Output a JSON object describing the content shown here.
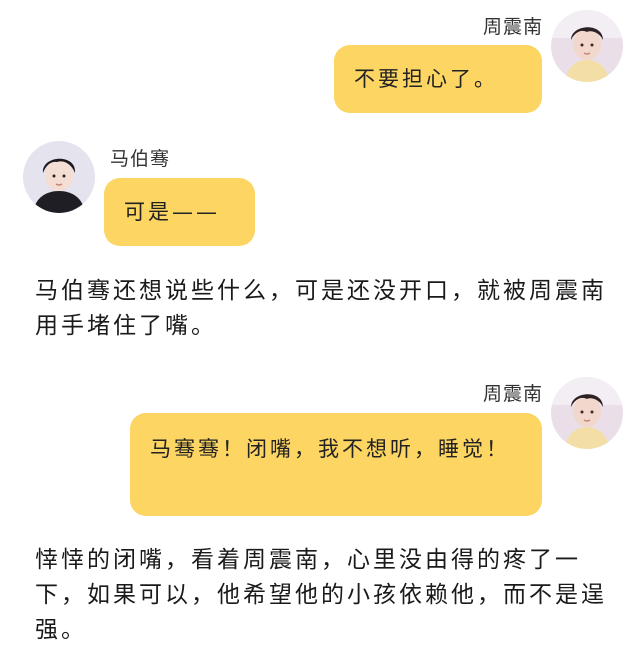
{
  "conversation": {
    "msg1": {
      "sender": "周震南",
      "text": "不要担心了。"
    },
    "msg2": {
      "sender": "马伯骞",
      "text": "可是——"
    },
    "narration1": "马伯骞还想说些什么，可是还没开口，就被周震南用手堵住了嘴。",
    "msg3": {
      "sender": "周震南",
      "text": "马骞骞！闭嘴，我不想听，睡觉！"
    },
    "narration2": "悻悻的闭嘴，看着周震南，心里没由得的疼了一下，如果可以，他希望他的小孩依赖他，而不是逞强。"
  },
  "colors": {
    "bubble": "#fcd562",
    "background": "#ffffff",
    "text": "#1a1a1a"
  }
}
